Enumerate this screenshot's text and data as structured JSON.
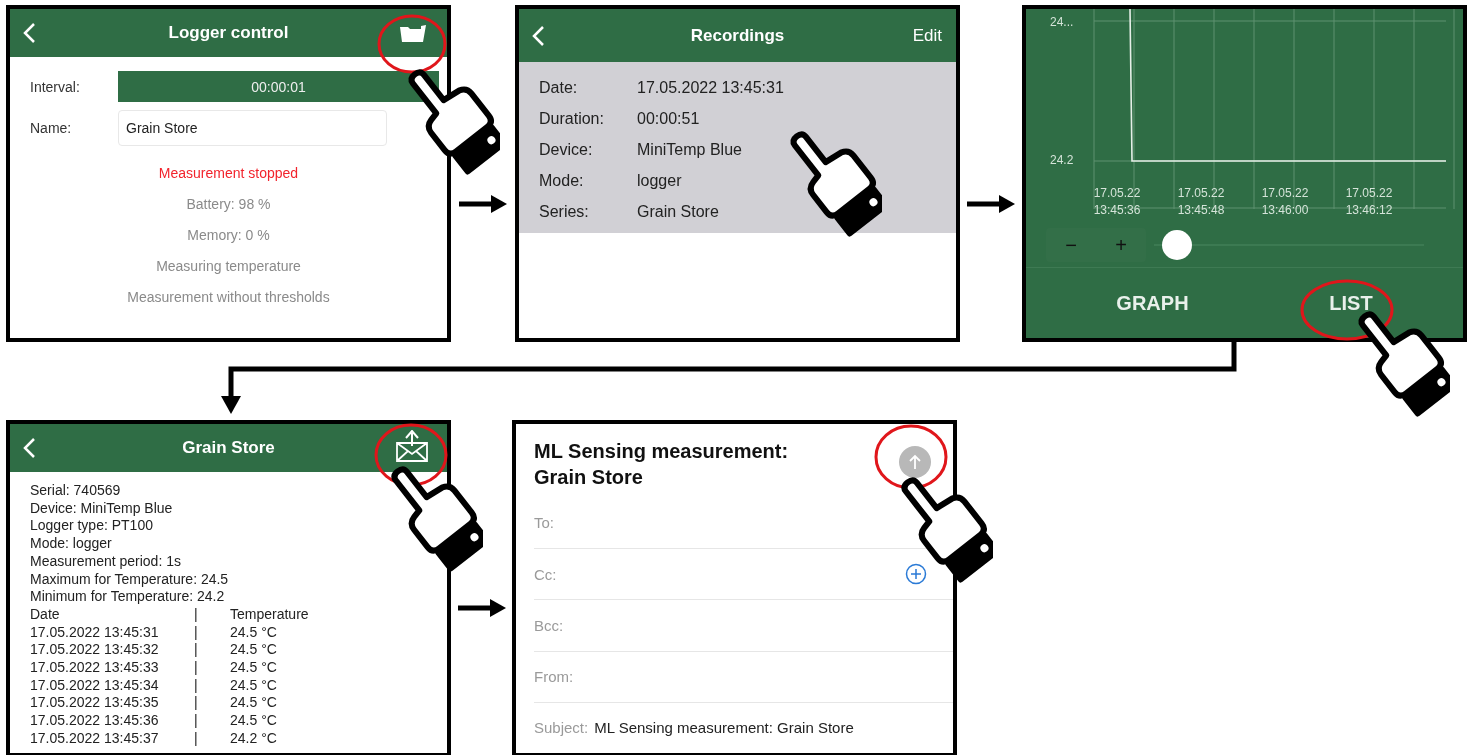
{
  "logger_control": {
    "title": "Logger control",
    "interval": {
      "label": "Interval:",
      "value": "00:00:01"
    },
    "name": {
      "label": "Name:",
      "value": "Grain Store"
    },
    "status": {
      "text": "Measurement stopped",
      "kind": "error"
    },
    "info_lines": [
      "Battery: 98 %",
      "Memory: 0 %",
      "Measuring temperature",
      "Measurement without thresholds"
    ]
  },
  "recordings": {
    "title": "Recordings",
    "edit": "Edit",
    "selected_entry": [
      {
        "label": "Date:",
        "value": "17.05.2022 13:45:31"
      },
      {
        "label": "Duration:",
        "value": "00:00:51"
      },
      {
        "label": "Device:",
        "value": "MiniTemp Blue"
      },
      {
        "label": "Mode:",
        "value": "logger"
      },
      {
        "label": "Series:",
        "value": "Grain Store"
      }
    ]
  },
  "graph": {
    "y_tick_labels": [
      "24...",
      "24.2"
    ],
    "x_tick_labels": [
      {
        "date": "17.05.22",
        "time": "13:45:36"
      },
      {
        "date": "17.05.22",
        "time": "13:45:48"
      },
      {
        "date": "17.05.22",
        "time": "13:46:00"
      },
      {
        "date": "17.05.22",
        "time": "13:46:12"
      }
    ],
    "zoom_out": "−",
    "zoom_in": "+",
    "zoom": {
      "level": 0.05
    },
    "tabs": [
      "GRAPH",
      "LIST"
    ]
  },
  "list": {
    "title": "Grain Store",
    "info_lines": [
      "Serial: 740569",
      "Device: MiniTemp Blue",
      "Logger type: PT100",
      "Mode: logger",
      "Measurement period: 1s",
      "Maximum for Temperature: 24.5",
      "Minimum for Temperature: 24.2"
    ],
    "separator": "|",
    "columns": [
      "Date",
      "Temperature"
    ],
    "rows": [
      {
        "date": "17.05.2022 13:45:31",
        "temperature": "24.5 °C"
      },
      {
        "date": "17.05.2022 13:45:32",
        "temperature": "24.5 °C"
      },
      {
        "date": "17.05.2022 13:45:33",
        "temperature": "24.5 °C"
      },
      {
        "date": "17.05.2022 13:45:34",
        "temperature": "24.5 °C"
      },
      {
        "date": "17.05.2022 13:45:35",
        "temperature": "24.5 °C"
      },
      {
        "date": "17.05.2022 13:45:36",
        "temperature": "24.5 °C"
      },
      {
        "date": "17.05.2022 13:45:37",
        "temperature": "24.2 °C"
      }
    ]
  },
  "email": {
    "title": "ML Sensing measurement: Grain Store",
    "fields": [
      {
        "label": "To:",
        "kind": "plain"
      },
      {
        "label": "Cc:",
        "kind": "add"
      },
      {
        "label": "Bcc:",
        "kind": "plain"
      },
      {
        "label": "From:",
        "kind": "plain"
      },
      {
        "label": "Subject:",
        "kind": "value",
        "value": "ML Sensing measurement: Grain Store"
      }
    ]
  }
}
